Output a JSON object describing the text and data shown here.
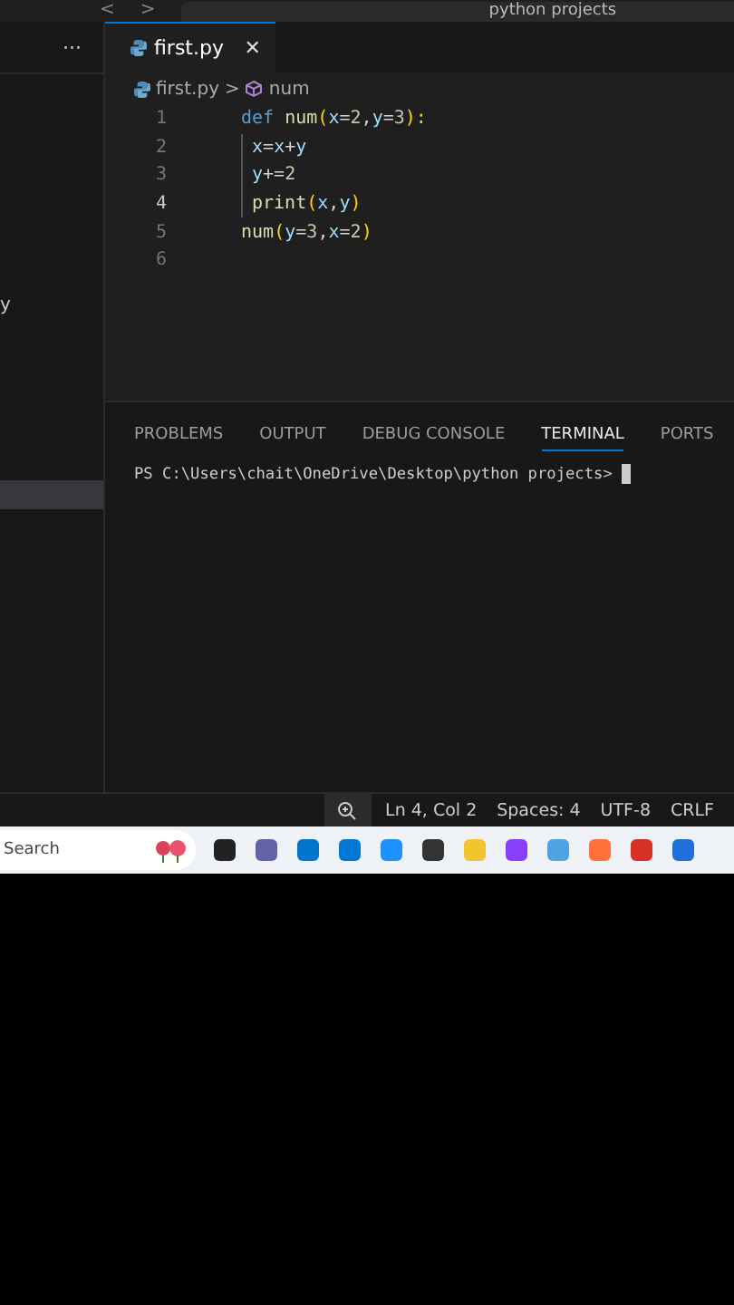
{
  "title_bar": {
    "back": "<",
    "forward": ">",
    "search": "python projects"
  },
  "sidebar": {
    "more": "···",
    "items": [
      {
        "label": "y",
        "selected": false
      },
      {
        "selected": true
      }
    ]
  },
  "tabs": [
    {
      "label": "first.py",
      "selected": true,
      "close": "✕"
    }
  ],
  "breadcrumbs": [
    {
      "label": "first.py",
      "kind": "file"
    },
    {
      "label": "num",
      "kind": "symbol"
    }
  ],
  "breadcrumb_separator": ">",
  "editor": {
    "lines": [
      {
        "number": "1",
        "indent": false,
        "current": false,
        "tokens": [
          {
            "text": "def ",
            "kind": "keyword"
          },
          {
            "text": "num",
            "kind": "function"
          },
          {
            "text": "(",
            "kind": "paren"
          },
          {
            "text": "x",
            "kind": "param"
          },
          {
            "text": "=",
            "kind": "plain"
          },
          {
            "text": "2",
            "kind": "number"
          },
          {
            "text": ",",
            "kind": "plain"
          },
          {
            "text": "y",
            "kind": "param"
          },
          {
            "text": "=",
            "kind": "plain"
          },
          {
            "text": "3",
            "kind": "number"
          },
          {
            "text": "):",
            "kind": "paren"
          }
        ]
      },
      {
        "number": "2",
        "indent": true,
        "current": false,
        "tokens": [
          {
            "text": "x",
            "kind": "param"
          },
          {
            "text": "=",
            "kind": "plain"
          },
          {
            "text": "x",
            "kind": "param"
          },
          {
            "text": "+",
            "kind": "plain"
          },
          {
            "text": "y",
            "kind": "param"
          }
        ]
      },
      {
        "number": "3",
        "indent": true,
        "current": false,
        "tokens": [
          {
            "text": "y",
            "kind": "param"
          },
          {
            "text": "+=",
            "kind": "plain"
          },
          {
            "text": "2",
            "kind": "number"
          }
        ]
      },
      {
        "number": "4",
        "indent": true,
        "current": true,
        "tokens": [
          {
            "text": "print",
            "kind": "function"
          },
          {
            "text": "(",
            "kind": "paren"
          },
          {
            "text": "x",
            "kind": "param"
          },
          {
            "text": ",",
            "kind": "plain"
          },
          {
            "text": "y",
            "kind": "param"
          },
          {
            "text": ")",
            "kind": "paren"
          }
        ]
      },
      {
        "number": "5",
        "indent": false,
        "current": false,
        "tokens": [
          {
            "text": "num",
            "kind": "function"
          },
          {
            "text": "(",
            "kind": "paren"
          },
          {
            "text": "y",
            "kind": "param"
          },
          {
            "text": "=",
            "kind": "plain"
          },
          {
            "text": "3",
            "kind": "number"
          },
          {
            "text": ",",
            "kind": "plain"
          },
          {
            "text": "x",
            "kind": "param"
          },
          {
            "text": "=",
            "kind": "plain"
          },
          {
            "text": "2",
            "kind": "number"
          },
          {
            "text": ")",
            "kind": "paren"
          }
        ]
      },
      {
        "number": "6",
        "indent": false,
        "current": false
      }
    ]
  },
  "panel": {
    "tabs": [
      {
        "label": "PROBLEMS",
        "selected": false
      },
      {
        "label": "OUTPUT",
        "selected": false
      },
      {
        "label": "DEBUG CONSOLE",
        "selected": false
      },
      {
        "label": "TERMINAL",
        "selected": true
      },
      {
        "label": "PORTS",
        "selected": false
      }
    ],
    "prompt": "PS C:\\Users\\chait\\OneDrive\\Desktop\\python projects>"
  },
  "status_bar": {
    "items": [
      "Ln 4, Col 2",
      "Spaces: 4",
      "UTF-8",
      "CRLF"
    ]
  },
  "taskbar": {
    "search_placeholder": "Search"
  }
}
